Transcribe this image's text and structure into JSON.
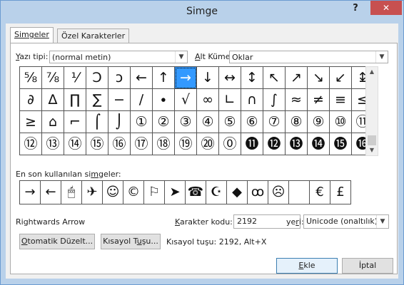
{
  "window": {
    "title": "Simge",
    "help": "?",
    "close": "✕"
  },
  "tabs": [
    "Simgeler",
    "Özel Karakterler"
  ],
  "font_label_pre": "Y",
  "font_label_post": "azı tipi:",
  "font_value": "(normal metin)",
  "subset_label_pre": "A",
  "subset_label_post": "lt Küme:",
  "subset_value": "Oklar",
  "grid": [
    [
      "⅝",
      "⅞",
      "⅟",
      "Ↄ",
      "ↄ",
      "←",
      "↑",
      "→",
      "↓",
      "↔",
      "↕",
      "↖",
      "↗",
      "↘",
      "↙",
      "↨"
    ],
    [
      "∂",
      "∆",
      "∏",
      "∑",
      "−",
      "∕",
      "∙",
      "√",
      "∞",
      "∟",
      "∩",
      "∫",
      "≈",
      "≠",
      "≡",
      "≤"
    ],
    [
      "≥",
      "⌂",
      "⌐",
      "⌠",
      "⌡",
      "①",
      "②",
      "③",
      "④",
      "⑤",
      "⑥",
      "⑦",
      "⑧",
      "⑨",
      "⑩",
      "⑪"
    ],
    [
      "⑫",
      "⑬",
      "⑭",
      "⑮",
      "⑯",
      "⑰",
      "⑱",
      "⑲",
      "⑳",
      "⓪",
      "⓫",
      "⓬",
      "⓭",
      "⓮",
      "⓯",
      "⓰"
    ]
  ],
  "selected": {
    "row": 0,
    "col": 7
  },
  "recent_label_pre": "En son kullanılan si",
  "recent_label_u": "m",
  "recent_label_post": "geler:",
  "recent": [
    "→",
    "←",
    "🖱",
    "✈",
    "☺",
    "©",
    "⚐",
    "➤",
    "☎",
    "☪",
    "◆",
    "ꝏ",
    "☹",
    "",
    "€",
    "£"
  ],
  "char_name": "Rightwards Arrow",
  "code_label_pre": "",
  "code_label_u": "K",
  "code_label_post": "arakter kodu:",
  "code_value": "2192",
  "from_label_pre": "ye",
  "from_label_u": "r",
  "from_label_post": "i:",
  "from_value": "Unicode (onaltılık)",
  "autocorrect_pre": "O",
  "autocorrect_post": "tomatik Düzelt...",
  "shortcut_btn_pre": "Kısayol T",
  "shortcut_btn_u": "u",
  "shortcut_btn_post": "şu...",
  "shortcut_text": "Kısayol tuşu: 2192, Alt+X",
  "insert_pre": "",
  "insert_u": "E",
  "insert_post": "kle",
  "cancel": "İptal"
}
